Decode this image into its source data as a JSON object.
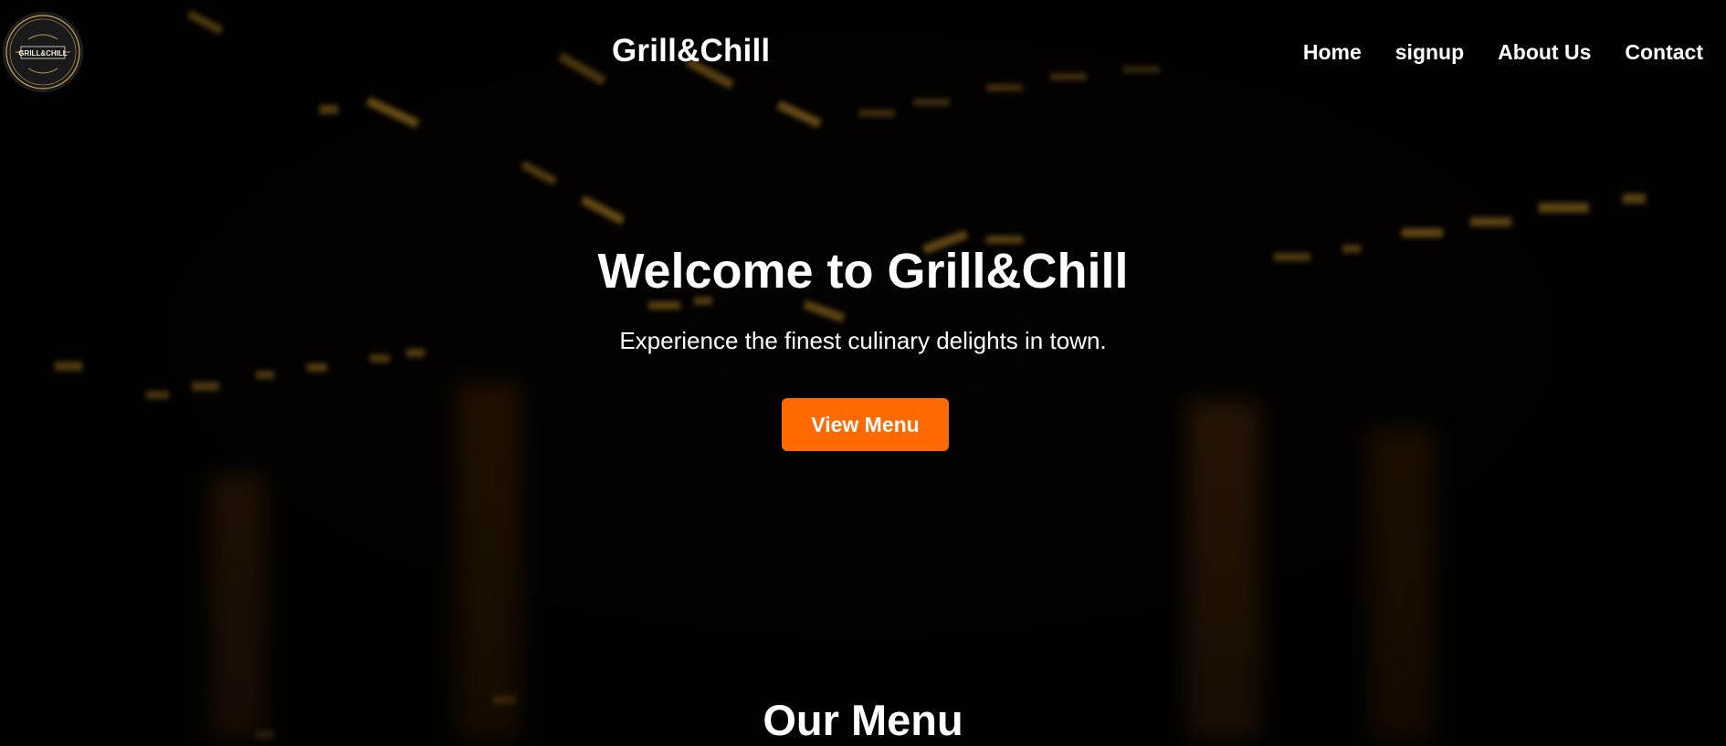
{
  "header": {
    "logo": {
      "icon": "grill-and-chill-logo",
      "text": "GRILL&CHILL"
    },
    "site_title": "Grill&Chill",
    "nav": [
      {
        "label": "Home"
      },
      {
        "label": "signup"
      },
      {
        "label": "About Us"
      },
      {
        "label": "Contact"
      }
    ]
  },
  "hero": {
    "heading": "Welcome to Grill&Chill",
    "subheading": "Experience the finest culinary delights in town.",
    "cta_label": "View Menu"
  },
  "menu_section": {
    "title": "Our Menu"
  },
  "colors": {
    "background": "#050302",
    "accent": "#ff6a00",
    "bokeh": "#f0b030",
    "text": "#ffffff"
  }
}
